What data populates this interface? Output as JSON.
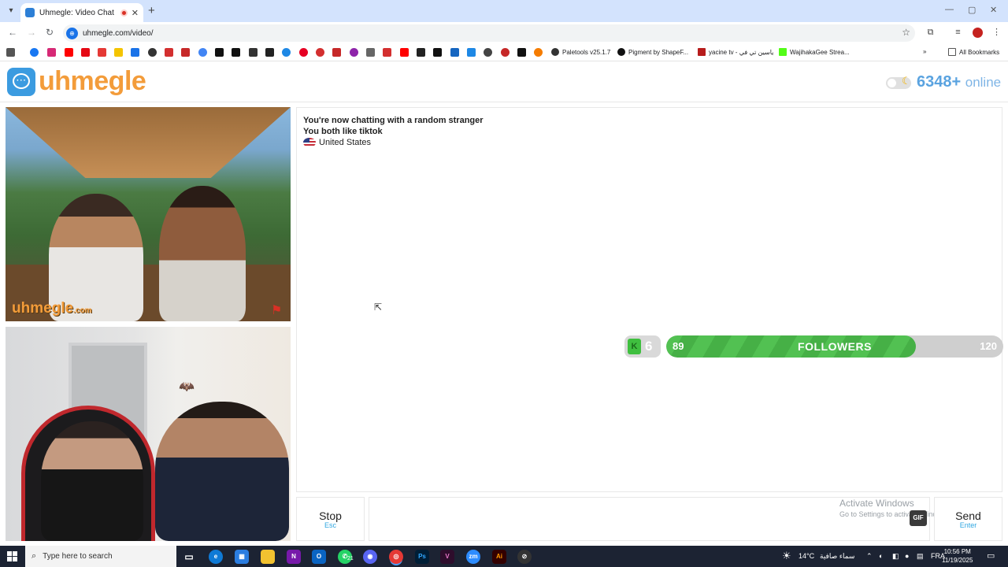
{
  "browser": {
    "tab_title": "Uhmegle: Video Chat | Ran",
    "url": "uhmegle.com/video/",
    "bookmarks": [
      {
        "label": "Paletools v25.1.7"
      },
      {
        "label": "Pigment by ShapeF..."
      },
      {
        "label": "yacine tv - ياسين تي في"
      },
      {
        "label": "WajihakaGee Strea..."
      },
      {
        "label": "All Bookmarks"
      }
    ]
  },
  "header": {
    "logo_text": "uhmegle",
    "online_count": "6348+",
    "online_label": "online"
  },
  "stranger_video": {
    "watermark": "uhmegle",
    "watermark_domain": ".com"
  },
  "chat": {
    "status_line": "You're now chatting with a random stranger",
    "common_interest": "You both like tiktok",
    "country": "United States"
  },
  "followers": {
    "level": "6",
    "current": "89",
    "label": "FOLLOWERS",
    "goal": "120",
    "progress_fraction": 0.74
  },
  "controls": {
    "stop_label": "Stop",
    "stop_hint": "Esc",
    "send_label": "Send",
    "send_hint": "Enter",
    "gif_label": "GIF"
  },
  "watermark_windows": {
    "title": "Activate Windows",
    "subtitle": "Go to Settings to activate Windows."
  },
  "taskbar": {
    "search_placeholder": "Type here to search",
    "whatsapp_badge": "21",
    "temperature": "14°C",
    "weather": "سماء صافية",
    "language": "FRA",
    "time": "10:56 PM",
    "date": "11/19/2025"
  },
  "colors": {
    "brand_orange": "#f39c3a",
    "brand_blue": "#3b9be0",
    "followers_green": "#52c152"
  }
}
